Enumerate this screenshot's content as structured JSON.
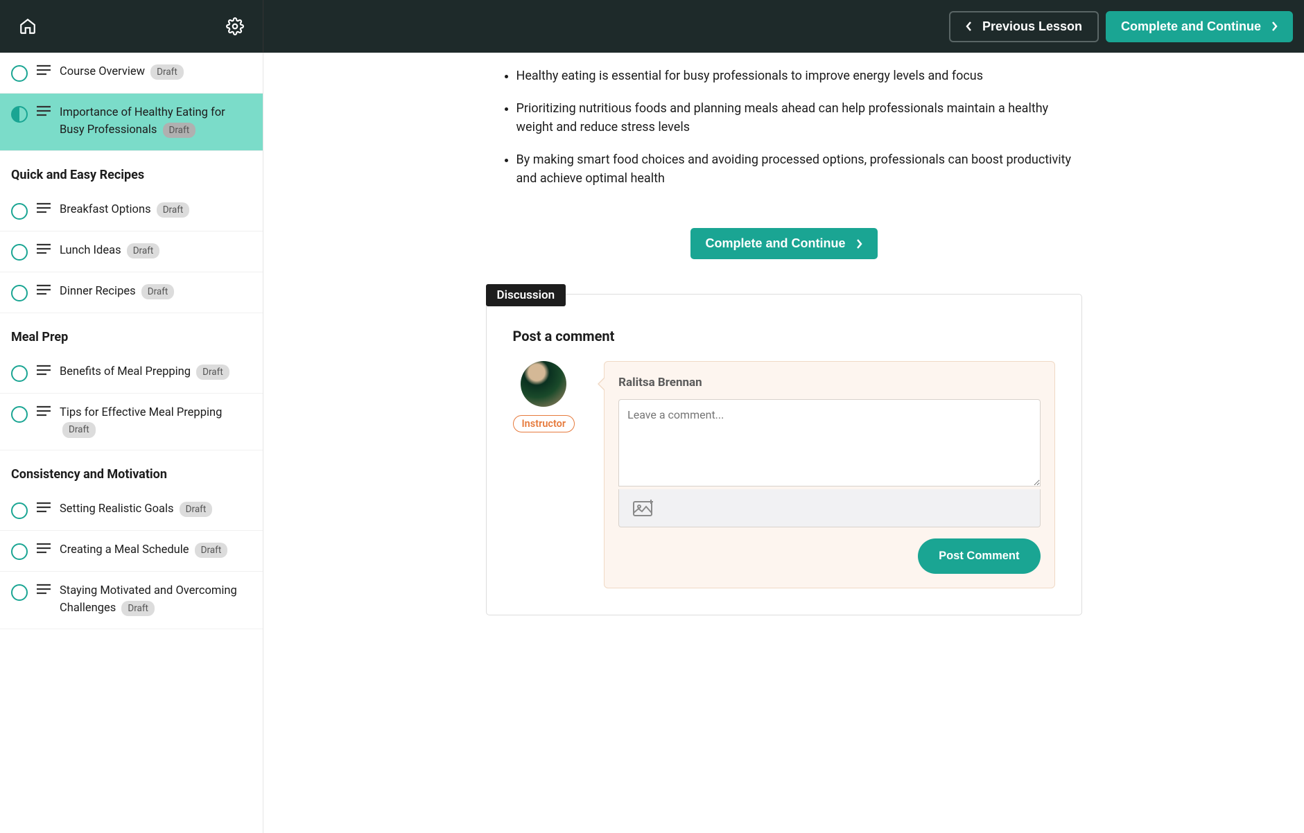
{
  "header": {
    "previous_label": "Previous Lesson",
    "complete_label": "Complete and Continue"
  },
  "sidebar": {
    "top_items": [
      {
        "label": "Course Overview",
        "draft": "Draft",
        "status": "incomplete"
      },
      {
        "label": "Importance of Healthy Eating for Busy Professionals",
        "draft": "Draft",
        "status": "current",
        "active": true
      }
    ],
    "sections": [
      {
        "title": "Quick and Easy Recipes",
        "items": [
          {
            "label": "Breakfast Options",
            "draft": "Draft",
            "status": "incomplete"
          },
          {
            "label": "Lunch Ideas",
            "draft": "Draft",
            "status": "incomplete"
          },
          {
            "label": "Dinner Recipes",
            "draft": "Draft",
            "status": "incomplete"
          }
        ]
      },
      {
        "title": "Meal Prep",
        "items": [
          {
            "label": "Benefits of Meal Prepping",
            "draft": "Draft",
            "status": "incomplete"
          },
          {
            "label": "Tips for Effective Meal Prepping",
            "draft": "Draft",
            "status": "incomplete"
          }
        ]
      },
      {
        "title": "Consistency and Motivation",
        "items": [
          {
            "label": "Setting Realistic Goals",
            "draft": "Draft",
            "status": "incomplete"
          },
          {
            "label": "Creating a Meal Schedule",
            "draft": "Draft",
            "status": "incomplete"
          },
          {
            "label": "Staying Motivated and Overcoming Challenges",
            "draft": "Draft",
            "status": "incomplete"
          }
        ]
      }
    ]
  },
  "content": {
    "bullets": [
      "Healthy eating is essential for busy professionals to improve energy levels and focus",
      "Prioritizing nutritious foods and planning meals ahead can help professionals maintain a healthy weight and reduce stress levels",
      "By making smart food choices and avoiding processed options, professionals can boost productivity and achieve optimal health"
    ],
    "continue_label": "Complete and Continue"
  },
  "discussion": {
    "tab_label": "Discussion",
    "title": "Post a comment",
    "instructor_label": "Instructor",
    "commenter_name": "Ralitsa Brennan",
    "placeholder": "Leave a comment...",
    "post_label": "Post Comment"
  }
}
